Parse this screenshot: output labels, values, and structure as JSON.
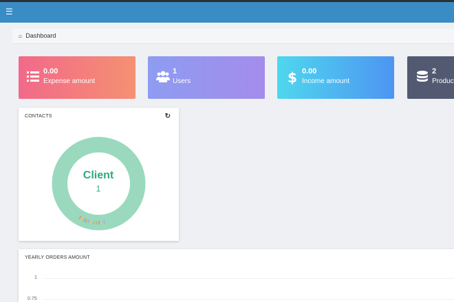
{
  "topbar": {
    "menu_icon": "menu-icon"
  },
  "breadcrumb": {
    "icon": "home-icon",
    "label": "Dashboard"
  },
  "stats": [
    {
      "value": "0.00",
      "label": "Expense amount",
      "icon": "list-icon"
    },
    {
      "value": "1",
      "label": "Users",
      "icon": "users-icon"
    },
    {
      "value": "0.00",
      "label": "Income amount",
      "icon": "dollar-icon"
    },
    {
      "value": "2",
      "label": "Product",
      "icon": "database-icon"
    }
  ],
  "contacts": {
    "title": "CONTACTS",
    "refresh_icon": "refresh-icon",
    "center_label": "Client",
    "center_value": "1"
  },
  "yearly": {
    "title": "YEARLY ORDERS AMOUNT",
    "y_ticks": [
      "1",
      "0.75"
    ]
  },
  "colors": {
    "topbar": "#3a8cc4",
    "donut_main": "#9ad9bd",
    "donut_text": "#2daa78"
  }
}
